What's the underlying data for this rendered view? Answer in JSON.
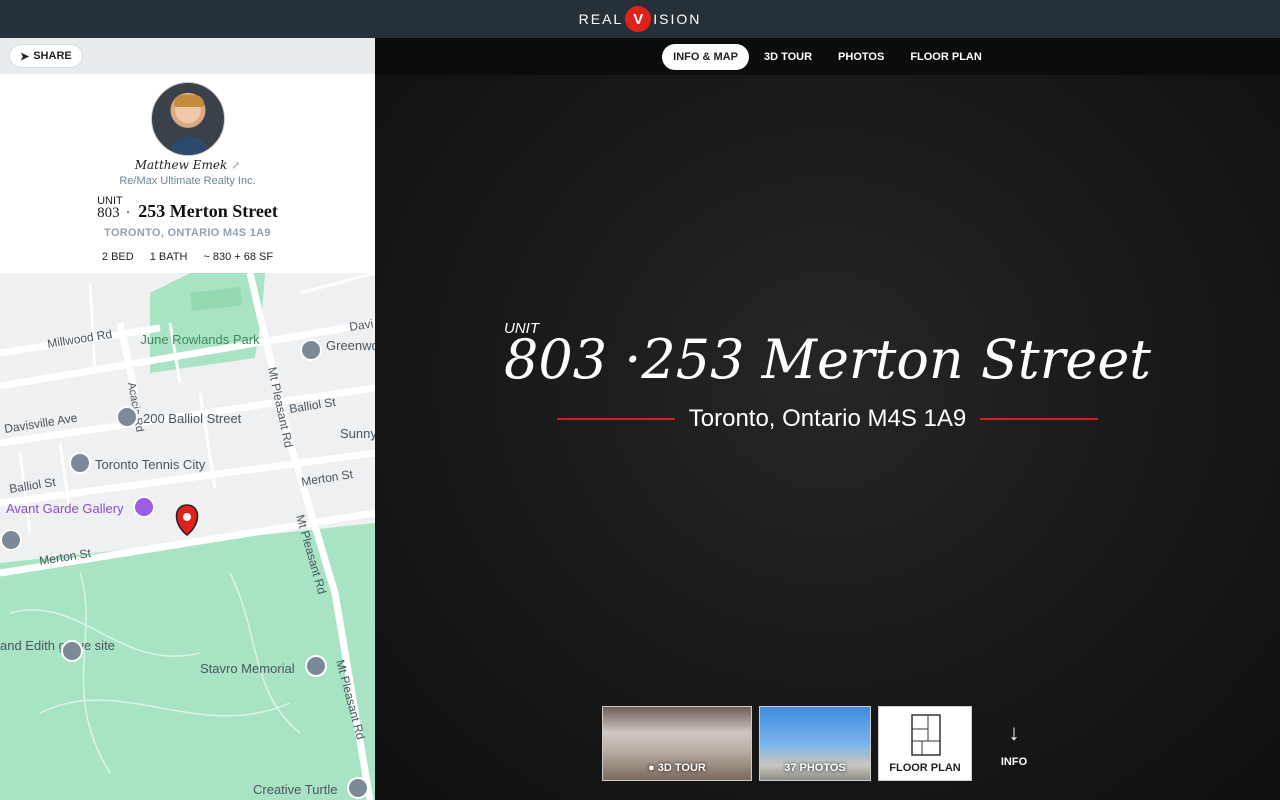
{
  "brand": {
    "left": "REAL",
    "mid": "V",
    "right": "ISION"
  },
  "share": {
    "label": "SHARE"
  },
  "agent": {
    "name": "Matthew Emek",
    "brokerage": "Re/Max Ultimate Realty Inc."
  },
  "listing": {
    "unit_label": "UNIT",
    "unit": "803",
    "separator": "·",
    "street": "253 Merton Street",
    "city_caps": "TORONTO, ONTARIO M4S 1A9",
    "city": "Toronto, Ontario M4S 1A9",
    "beds": "2 BED",
    "baths": "1 BATH",
    "area": "~ 830 + 68 SF"
  },
  "tabs": [
    {
      "label": "INFO & MAP"
    },
    {
      "label": "3D TOUR"
    },
    {
      "label": "PHOTOS"
    },
    {
      "label": "FLOOR PLAN"
    }
  ],
  "thumbs": {
    "tour": "3D TOUR",
    "photos": "37 PHOTOS",
    "floor": "FLOOR PLAN",
    "info": "INFO"
  },
  "map": {
    "streets": [
      "Millwood Rd",
      "Acacia Rd",
      "Davisville Ave",
      "Balliol St",
      "Balliol St",
      "Merton St",
      "Merton St",
      "Mt Pleasant Rd",
      "Mt Pleasant Rd",
      "Mt Pleasant Rd",
      "Davi"
    ],
    "places": [
      "June Rowlands Park",
      "Greenwood College",
      "200 Balliol Street",
      "Toronto Tennis City",
      "Avant Garde Gallery",
      "Sunny",
      "and Edith grave site",
      "Stavro Memorial",
      "Creative Turtle"
    ]
  },
  "colors": {
    "accent": "#e0211c",
    "park": "#a8e4c3",
    "road": "#ffffff"
  }
}
